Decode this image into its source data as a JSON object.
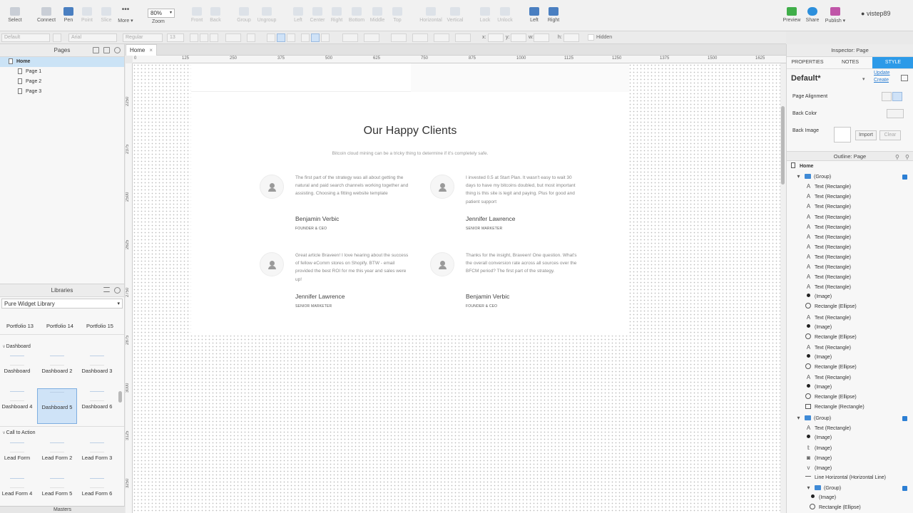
{
  "toolbar": {
    "tools": [
      {
        "label": "Select",
        "icon": "select-icon",
        "enabled": true
      },
      {
        "label": "Connect",
        "icon": "connect-icon",
        "enabled": true
      },
      {
        "label": "Pen",
        "icon": "pen-icon",
        "enabled": true
      },
      {
        "label": "Point",
        "icon": "point-icon",
        "enabled": false
      },
      {
        "label": "Slice",
        "icon": "slice-icon",
        "enabled": false
      },
      {
        "label": "More ▾",
        "icon": "more-icon",
        "enabled": true
      }
    ],
    "zoom_value": "80%",
    "zoom_label": "Zoom",
    "arrange": [
      {
        "label": "Front",
        "enabled": false
      },
      {
        "label": "Back",
        "enabled": false
      },
      {
        "label": "Group",
        "enabled": false
      },
      {
        "label": "Ungroup",
        "enabled": false
      },
      {
        "label": "Left",
        "enabled": false
      },
      {
        "label": "Center",
        "enabled": false
      },
      {
        "label": "Right",
        "enabled": false
      },
      {
        "label": "Bottom",
        "enabled": false
      },
      {
        "label": "Middle",
        "enabled": false
      },
      {
        "label": "Top",
        "enabled": false
      },
      {
        "label": "Horizontal",
        "enabled": false
      },
      {
        "label": "Vertical",
        "enabled": false
      },
      {
        "label": "Lock",
        "enabled": false
      },
      {
        "label": "Unlock",
        "enabled": false
      },
      {
        "label": "Left",
        "enabled": true
      },
      {
        "label": "Right",
        "enabled": true
      }
    ],
    "right_actions": [
      {
        "label": "Preview",
        "icon": "preview-icon"
      },
      {
        "label": "Share",
        "icon": "cloud-upload-icon"
      },
      {
        "label": "Publish ▾",
        "icon": "publish-icon"
      }
    ],
    "user": "vistep89"
  },
  "format_bar": {
    "style": "Default",
    "font": "Arial",
    "weight": "Regular",
    "size": "13",
    "x_label": "x:",
    "y_label": "y:",
    "w_label": "w:",
    "h_label": "h:",
    "hidden_label": "Hidden"
  },
  "pages": {
    "title": "Pages",
    "items": [
      {
        "label": "Home",
        "selected": true,
        "level": 0
      },
      {
        "label": "Page 1",
        "selected": false,
        "level": 1
      },
      {
        "label": "Page 2",
        "selected": false,
        "level": 1
      },
      {
        "label": "Page 3",
        "selected": false,
        "level": 1
      }
    ]
  },
  "libraries": {
    "title": "Libraries",
    "selected_library": "Pure Widget Library",
    "portfolio_items": [
      "Portfolio 13",
      "Portfolio 14",
      "Portfolio 15"
    ],
    "sections": [
      {
        "title": "Dashboard",
        "items": [
          "Dashboard",
          "Dashboard 2",
          "Dashboard 3",
          "Dashboard 4",
          "Dashboard 5",
          "Dashboard 6"
        ],
        "selected": "Dashboard 5"
      },
      {
        "title": "Call to Action",
        "items": [
          "Lead Form",
          "Lead Form 2",
          "Lead Form 3",
          "Lead Form 4",
          "Lead Form 5",
          "Lead Form 6"
        ]
      }
    ],
    "masters_title": "Masters"
  },
  "canvas": {
    "tab": "Home",
    "ruler_h": [
      "0",
      "125",
      "250",
      "375",
      "500",
      "625",
      "750",
      "875",
      "1000",
      "1125",
      "1250",
      "1375",
      "1500",
      "1625"
    ],
    "ruler_v": [
      "2250",
      "2375",
      "2500",
      "2625",
      "2750",
      "2875",
      "3000",
      "3125",
      "3250"
    ],
    "section": {
      "title": "Our Happy Clients",
      "subtitle": "Bitcoin cloud mining can be a tricky thing to determine if it's completely safe.",
      "testimonials": [
        {
          "quote": "The first part of the strategy was all about getting the natural and paid search channels working together and assisting. Choosing a fitting website template",
          "name": "Benjamin Verbic",
          "role": "FOUNDER & CEO"
        },
        {
          "quote": "I invested 0.5 at Start Plan. It wasn't easy to wait 30 days to have my bitcoins doubled, but most important thing is this site is legit and paying. Plus for good and patient support",
          "name": "Jennifer Lawrence",
          "role": "SENIOR MARKETER"
        },
        {
          "quote": "Great article Braveen! I love hearing about the success of fellow eComm stores on Shopify. BTW - email provided the best ROI for me this year and sales were up!",
          "name": "Jennifer Lawrence",
          "role": "SENIOR MARKETER"
        },
        {
          "quote": "Thanks for the insight, Braveen! One question. What's the overall conversion rate across all sources over the BFCM period? The first part of the strategy.",
          "name": "Benjamin Verbic",
          "role": "FOUNDER & CEO"
        }
      ]
    }
  },
  "inspector": {
    "title": "Inspector: Page",
    "tabs": [
      "PROPERTIES",
      "NOTES",
      "STYLE"
    ],
    "active_tab": "STYLE",
    "style_name": "Default*",
    "update_link": "Update",
    "create_link": "Create",
    "page_alignment_label": "Page Alignment",
    "back_color_label": "Back Color",
    "back_image_label": "Back Image",
    "import_label": "Import",
    "clear_label": "Clear"
  },
  "outline": {
    "title": "Outline: Page",
    "items": [
      {
        "label": "Home",
        "kind": "doc",
        "indent": 0,
        "bold": true
      },
      {
        "label": "(Group)",
        "kind": "group",
        "indent": 1
      },
      {
        "label": "Text (Rectangle)",
        "kind": "text",
        "indent": 2
      },
      {
        "label": "Text (Rectangle)",
        "kind": "text",
        "indent": 2
      },
      {
        "label": "Text (Rectangle)",
        "kind": "text",
        "indent": 2
      },
      {
        "label": "Text (Rectangle)",
        "kind": "text",
        "indent": 2
      },
      {
        "label": "Text (Rectangle)",
        "kind": "text",
        "indent": 2
      },
      {
        "label": "Text (Rectangle)",
        "kind": "text",
        "indent": 2
      },
      {
        "label": "Text (Rectangle)",
        "kind": "text",
        "indent": 2
      },
      {
        "label": "Text (Rectangle)",
        "kind": "text",
        "indent": 2
      },
      {
        "label": "Text (Rectangle)",
        "kind": "text",
        "indent": 2
      },
      {
        "label": "Text (Rectangle)",
        "kind": "text",
        "indent": 2
      },
      {
        "label": "Text (Rectangle)",
        "kind": "text",
        "indent": 2
      },
      {
        "label": "(Image)",
        "kind": "image",
        "indent": 2
      },
      {
        "label": "Rectangle (Ellipse)",
        "kind": "ellipse",
        "indent": 2
      },
      {
        "label": "Text (Rectangle)",
        "kind": "text",
        "indent": 2
      },
      {
        "label": "(Image)",
        "kind": "image",
        "indent": 2
      },
      {
        "label": "Rectangle (Ellipse)",
        "kind": "ellipse",
        "indent": 2
      },
      {
        "label": "Text (Rectangle)",
        "kind": "text",
        "indent": 2
      },
      {
        "label": "(Image)",
        "kind": "image",
        "indent": 2
      },
      {
        "label": "Rectangle (Ellipse)",
        "kind": "ellipse",
        "indent": 2
      },
      {
        "label": "Text (Rectangle)",
        "kind": "text",
        "indent": 2
      },
      {
        "label": "(Image)",
        "kind": "image",
        "indent": 2
      },
      {
        "label": "Rectangle (Ellipse)",
        "kind": "ellipse",
        "indent": 2
      },
      {
        "label": "Rectangle (Rectangle)",
        "kind": "rect",
        "indent": 2
      },
      {
        "label": "(Group)",
        "kind": "group",
        "indent": 1
      },
      {
        "label": "Text (Rectangle)",
        "kind": "text",
        "indent": 2
      },
      {
        "label": "(Image)",
        "kind": "image",
        "indent": 2
      },
      {
        "label": "(Image)",
        "kind": "twitter",
        "indent": 2
      },
      {
        "label": "(Image)",
        "kind": "instagram",
        "indent": 2
      },
      {
        "label": "(Image)",
        "kind": "vimeo",
        "indent": 2
      },
      {
        "label": "Line Horizontal (Horizontal Line)",
        "kind": "line",
        "indent": 2
      },
      {
        "label": "(Group)",
        "kind": "group",
        "indent": 2
      },
      {
        "label": "(Image)",
        "kind": "image",
        "indent": 3
      },
      {
        "label": "Rectangle (Ellipse)",
        "kind": "ellipse",
        "indent": 3
      }
    ]
  },
  "colors": {
    "accent": "#2c9ae8",
    "selection": "#cbe3f6",
    "folder": "#3f8ad6"
  }
}
